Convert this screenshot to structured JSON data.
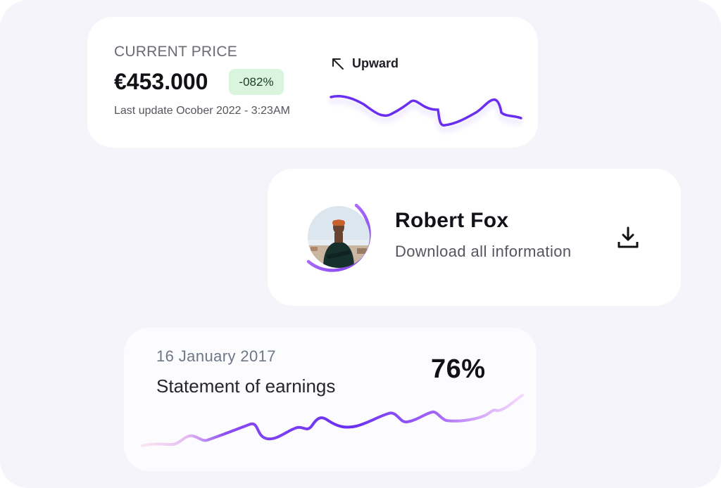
{
  "price_card": {
    "label": "CURRENT PRICE",
    "value": "€453.000",
    "change_badge": "-082%",
    "last_update": "Last update Ocober 2022 - 3:23AM",
    "trend_label": "Upward",
    "trend_icon": "arrow-up-left-icon"
  },
  "profile_card": {
    "name": "Robert Fox",
    "subtitle": "Download all information",
    "download_icon": "download-icon",
    "avatar": "avatar"
  },
  "earnings_card": {
    "date": "16 January 2017",
    "title": "Statement of earnings",
    "percent": "76%"
  },
  "colors": {
    "background": "#f4f4fa",
    "card": "#ffffff",
    "accent_purple": "#6a2ff0",
    "light_purple": "#d9a6ff",
    "badge_green": "#d9f5dd",
    "text_dark": "#111116",
    "text_muted": "#6b6b73"
  }
}
